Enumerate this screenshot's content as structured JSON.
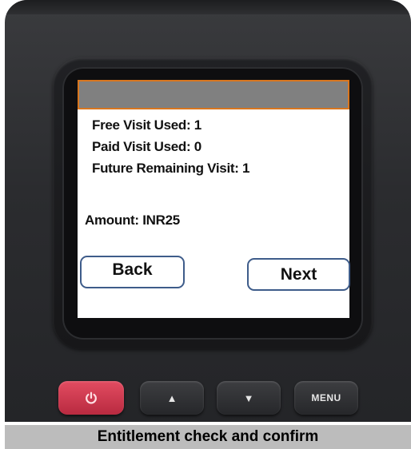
{
  "screen": {
    "lines": [
      "Free Visit Used: 1",
      "Paid Visit Used: 0",
      "Future Remaining Visit:  1"
    ],
    "amount": "Amount: INR25",
    "back_label": "Back",
    "next_label": "Next"
  },
  "keypad": {
    "power_icon": "power-icon",
    "up_glyph": "▲",
    "down_glyph": "▼",
    "menu_label": "MENU"
  },
  "caption": "Entitlement check and confirm",
  "colors": {
    "header_border": "#d9761f",
    "header_fill": "#808080",
    "button_border": "#3e5c8a",
    "power_key": "#d23b52"
  }
}
